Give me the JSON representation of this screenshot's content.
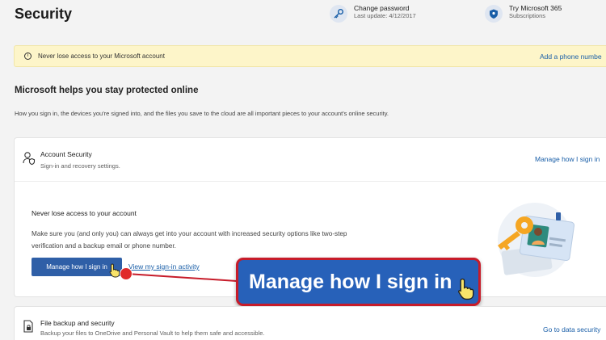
{
  "page": {
    "title": "Security"
  },
  "top_actions": [
    {
      "title": "Change password",
      "subtitle": "Last update: 4/12/2017",
      "icon": "key-icon"
    },
    {
      "title": "Try Microsoft 365",
      "subtitle": "Subscriptions",
      "icon": "shield-icon"
    }
  ],
  "banner": {
    "text": "Never lose access to your Microsoft account",
    "link": "Add a phone numbe",
    "icon": "info-icon"
  },
  "section": {
    "heading": "Microsoft helps you stay protected online",
    "description": "How you sign in, the devices you're signed into, and the files you save to the cloud are all important pieces to your account's online security."
  },
  "account_security": {
    "title": "Account Security",
    "subtitle": "Sign-in and recovery settings.",
    "header_link": "Manage how I sign in",
    "body_title": "Never lose access to your account",
    "body_text": "Make sure you (and only you) can always get into your account with increased security options like two-step verification and a backup email or phone number.",
    "primary_button": "Manage how I sign in",
    "secondary_link": "View my sign-in activity",
    "icon": "person-shield-icon"
  },
  "callout": {
    "text": "Manage how I sign in"
  },
  "file_backup": {
    "title": "File backup and security",
    "subtitle": "Backup your files to OneDrive and Personal Vault to help them safe and accessible.",
    "link": "Go to data security",
    "icon": "file-lock-icon"
  },
  "colors": {
    "accent": "#2f5fa7",
    "link": "#1a5fa8",
    "banner_bg": "#fdf5c9",
    "callout_bg": "#2761b9",
    "callout_border": "#c71c2a",
    "marker": "#e02a2a"
  }
}
